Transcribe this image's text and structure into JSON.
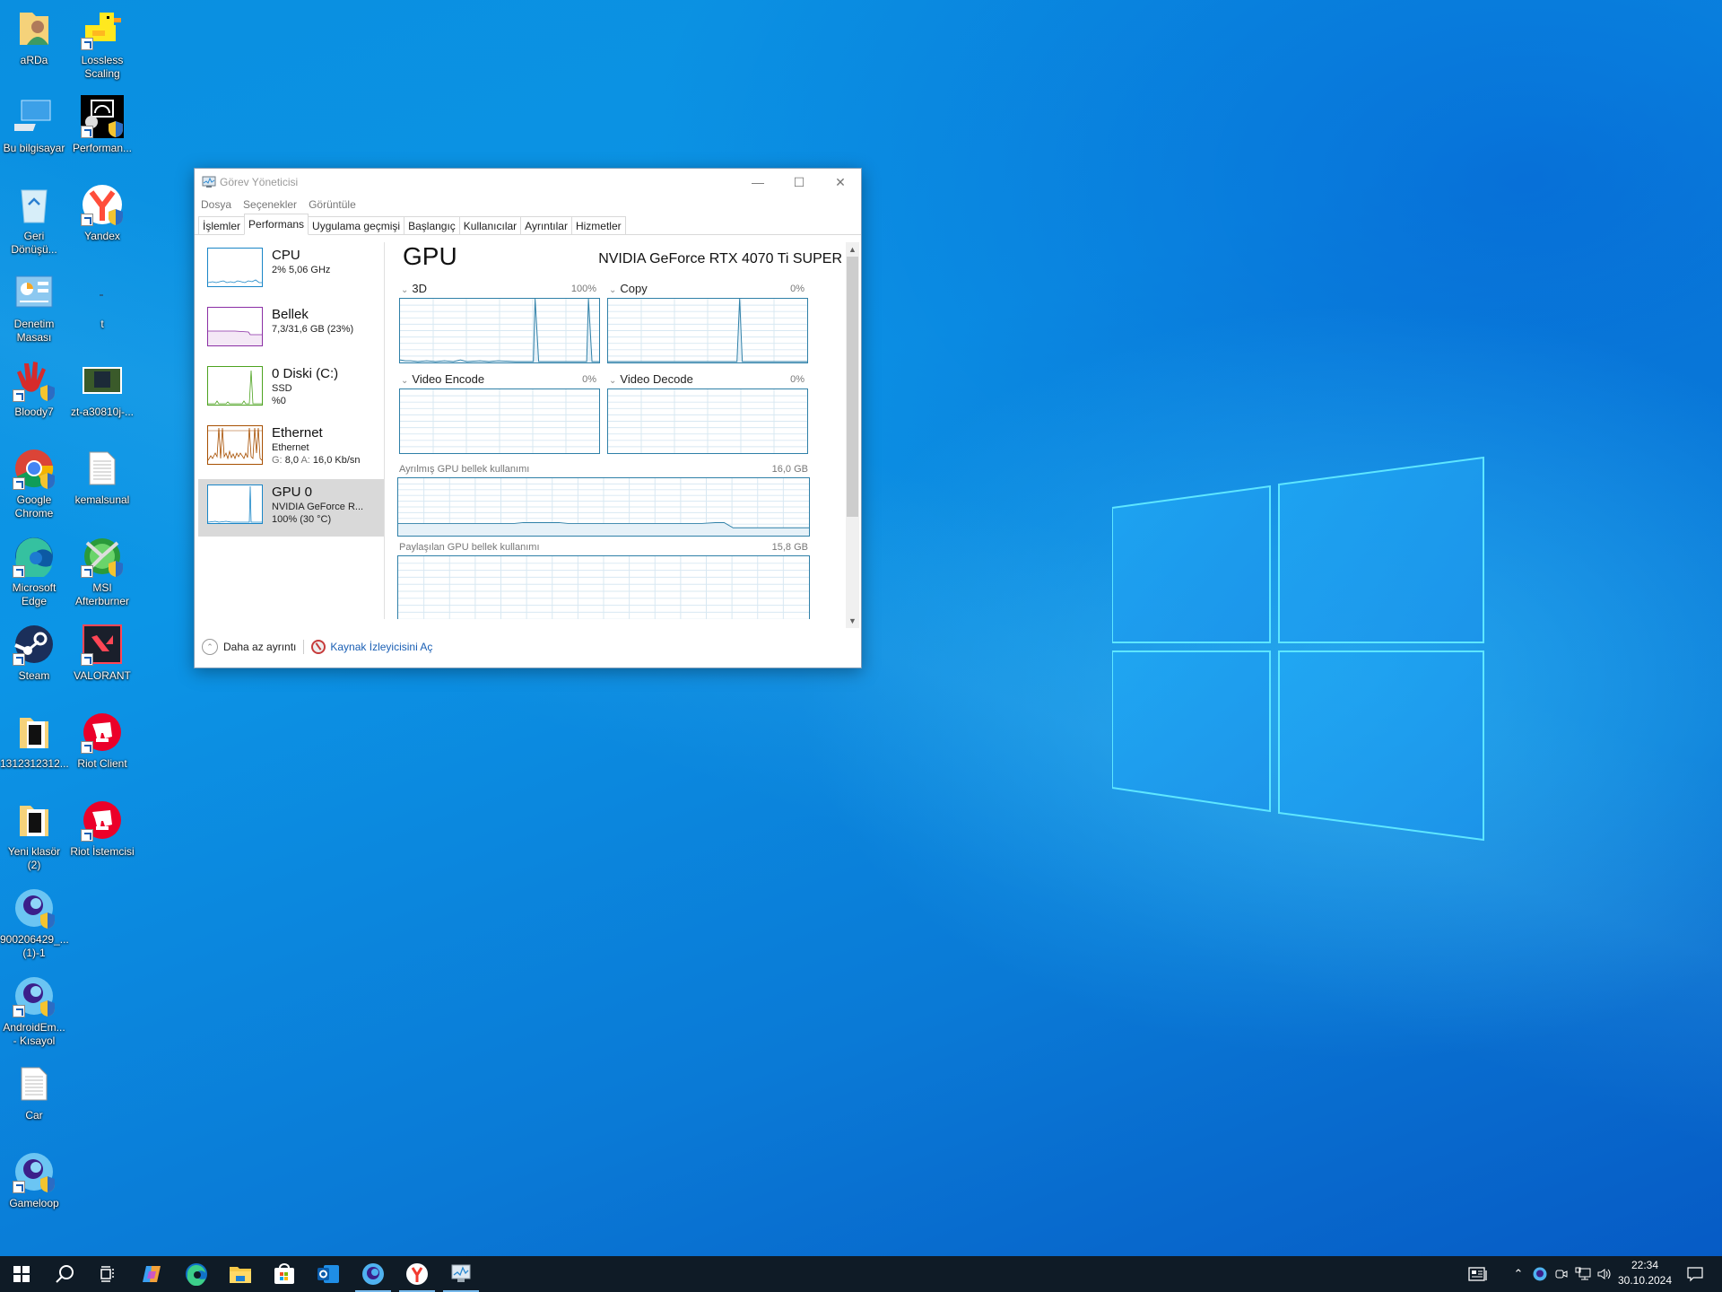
{
  "desktop": {
    "icons": [
      {
        "label": "aRDa",
        "icon": "user-folder-icon"
      },
      {
        "label": "Lossless Scaling",
        "icon": "duck-icon"
      },
      {
        "label": "Bu bilgisayar",
        "icon": "computer-icon"
      },
      {
        "label": "Performan...",
        "icon": "performance-icon"
      },
      {
        "label": "Geri Dönüşü...",
        "icon": "recycle-bin-icon"
      },
      {
        "label": "Yandex",
        "icon": "yandex-browser-icon"
      },
      {
        "label": "Denetim Masası",
        "icon": "control-panel-icon"
      },
      {
        "label": "t",
        "icon": "blank-icon"
      },
      {
        "label": "Bloody7",
        "icon": "bloody-hand-icon"
      },
      {
        "label": "zt-a30810j-...",
        "icon": "image-file-icon"
      },
      {
        "label": "Google Chrome",
        "icon": "chrome-icon"
      },
      {
        "label": "kemalsunal",
        "icon": "text-file-icon"
      },
      {
        "label": "Microsoft Edge",
        "icon": "edge-icon"
      },
      {
        "label": "MSI Afterburner",
        "icon": "afterburner-icon"
      },
      {
        "label": "Steam",
        "icon": "steam-icon"
      },
      {
        "label": "VALORANT",
        "icon": "valorant-icon"
      },
      {
        "label": "1312312312...",
        "icon": "folder-icon"
      },
      {
        "label": "Riot Client",
        "icon": "riot-icon"
      },
      {
        "label": "Yeni klasör (2)",
        "icon": "folder-icon"
      },
      {
        "label": "Riot İstemcisi",
        "icon": "riot-icon"
      },
      {
        "label": "900206429_... (1)-1",
        "icon": "gameloop-icon"
      },
      {
        "label": "AndroidEm... - Kısayol",
        "icon": "gameloop-icon"
      },
      {
        "label": "Car",
        "icon": "text-file-icon"
      },
      {
        "label": "Gameloop",
        "icon": "gameloop-icon"
      }
    ]
  },
  "taskmanager": {
    "title": "Görev Yöneticisi",
    "menu": [
      "Dosya",
      "Seçenekler",
      "Görüntüle"
    ],
    "tabs": [
      "İşlemler",
      "Performans",
      "Uygulama geçmişi",
      "Başlangıç",
      "Kullanıcılar",
      "Ayrıntılar",
      "Hizmetler"
    ],
    "active_tab": "Performans",
    "sidebar": [
      {
        "name": "CPU",
        "line1": "2%  5,06 GHz",
        "line2": "",
        "color": "#1a86c7"
      },
      {
        "name": "Bellek",
        "line1": "7,3/31,6 GB (23%)",
        "line2": "",
        "color": "#8b2fa5"
      },
      {
        "name": "0 Diski (C:)",
        "line1": "SSD",
        "line2": "%0",
        "color": "#4da320"
      },
      {
        "name": "Ethernet",
        "line1": "Ethernet",
        "line2_label_g": "G:",
        "line2_val_g": "8,0",
        "line2_label_a": "A:",
        "line2_val_a": "16,0 Kb/sn",
        "color": "#a74f01"
      },
      {
        "name": "GPU 0",
        "line1": "NVIDIA GeForce R...",
        "line2": "100%  (30 °C)",
        "color": "#1a86c7"
      }
    ],
    "selected": "GPU 0",
    "main": {
      "heading": "GPU",
      "gpu_name": "NVIDIA GeForce RTX 4070 Ti SUPER",
      "engines": [
        {
          "label": "3D",
          "pct": "100%"
        },
        {
          "label": "Copy",
          "pct": "0%"
        },
        {
          "label": "Video Encode",
          "pct": "0%"
        },
        {
          "label": "Video Decode",
          "pct": "0%"
        }
      ],
      "dedicated_label": "Ayrılmış GPU bellek kullanımı",
      "dedicated_max": "16,0 GB",
      "shared_label": "Paylaşılan GPU bellek kullanımı",
      "shared_max": "15,8 GB"
    },
    "footer": {
      "less_details": "Daha az ayrıntı",
      "resource_monitor": "Kaynak İzleyicisini Aç"
    }
  },
  "taskbar": {
    "pinned": [
      "start",
      "search",
      "task-view",
      "copilot",
      "edge",
      "file-explorer",
      "store",
      "outlook",
      "gameloop",
      "yandex",
      "task-manager"
    ],
    "clock_time": "22:34",
    "clock_date": "30.10.2024"
  }
}
